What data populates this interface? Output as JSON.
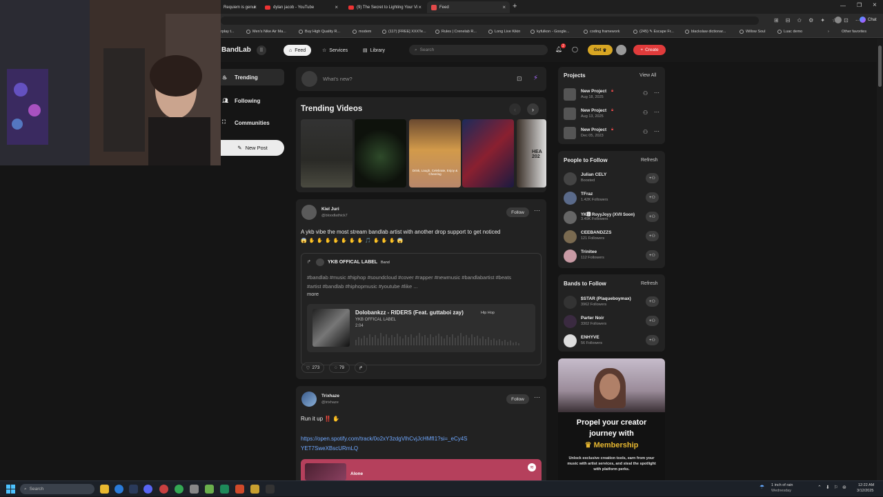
{
  "browser": {
    "tabs": [
      {
        "label": "Requiem is genui"
      },
      {
        "label": "dylan jacob - YouTube"
      },
      {
        "label": "(9) The Secret to Lighting Your Vi"
      },
      {
        "label": "Feed"
      }
    ],
    "new_tab": "+",
    "bookmarks": [
      "rplay t...",
      "Men's Nike Air Ma...",
      "Buy High Quality R...",
      "modem",
      "(117) [FREE] XXXTe...",
      "Rules | Crenelab R...",
      "Long Live Kikin",
      "kyfulkon - Google...",
      "coding framework",
      "(245) ✎ Escape Fr...",
      "blackslaw dictionar...",
      "Willow Soul",
      "Luac demo"
    ],
    "other_favorites": "Other favorites",
    "chat_label": "Chat"
  },
  "header": {
    "logo": "BandLab",
    "nav": {
      "feed": "Feed",
      "services": "Services",
      "library": "Library"
    },
    "search_placeholder": "Search",
    "notif_count": "2",
    "get_label": "Get",
    "create_label": "Create"
  },
  "sidebar": {
    "items": [
      {
        "label": "Trending"
      },
      {
        "label": "Following"
      },
      {
        "label": "Communities"
      }
    ],
    "new_post": "New Post"
  },
  "composer": {
    "placeholder": "What's new?"
  },
  "trending": {
    "title": "Trending Videos",
    "video_captions": [
      "",
      "",
      "Drink, Laugh, Celebrate, Enjoy & Cheering",
      "",
      "HEA 202"
    ]
  },
  "post1": {
    "author": "Kiel Juri",
    "handle": "@bloodlathick7",
    "follow": "Follow",
    "text": "A ykb vibe the most stream bandlab artist with another drop support to get noticed",
    "emojis": "😱 ✋ ✋ ✋ ✋ ✋ ✋ ✋ 🎵 ✋ ✋ ✋ 😱",
    "shared_label": "YKB OFFICAL LABEL",
    "shared_badge": "Band",
    "hashtags": "#bandlab #music #hiphop #soundcloud #cover #rapper #newmusic #bandlabartist #beats #artist #bandlab #hiphopmusic #youtube #like ...",
    "more": "more",
    "track_title": "Dolobankzz - RIDERS (Feat. guttaboi zay)",
    "track_genre": "Hip Hop",
    "track_artist": "YKB OFFICAL LABEL",
    "track_duration": "2:04",
    "likes": "273",
    "comments": "79"
  },
  "post2": {
    "author": "Trixhaze",
    "handle": "@trixhaze",
    "follow": "Follow",
    "text": "Run it up ‼️ ✋",
    "link": "https://open.spotify.com/track/0o2xY3zdgVlhCvjJcHMfI1?si=_eCy4SYET7SweXBscURmLQ",
    "track_title": "Alone"
  },
  "projects": {
    "title": "Projects",
    "view_all": "View All",
    "items": [
      {
        "name": "New Project",
        "date": "Aug 18, 2025"
      },
      {
        "name": "New Project",
        "date": "Aug 13, 2025"
      },
      {
        "name": "New Project",
        "date": "Dec 05, 2023"
      }
    ]
  },
  "people": {
    "title": "People to Follow",
    "refresh": "Refresh",
    "items": [
      {
        "name": "Julian CELY",
        "sub": "Boosted"
      },
      {
        "name": "TFraz",
        "sub": "1.42K Followers"
      },
      {
        "name": "YK🅱 RoyyJoyy (XVII Soon)",
        "sub": "3.49K Followers"
      },
      {
        "name": "CEEBANDZZS",
        "sub": "121 Followers"
      },
      {
        "name": "Trinitee",
        "sub": "112 Followers"
      }
    ]
  },
  "bands": {
    "title": "Bands to Follow",
    "refresh": "Refresh",
    "items": [
      {
        "name": "$STAR (Plaqueboymax)",
        "sub": "3962 Followers"
      },
      {
        "name": "Parter Noir",
        "sub": "3302 Followers"
      },
      {
        "name": "ENHYVE",
        "sub": "56 Followers"
      }
    ]
  },
  "promo": {
    "headline_1": "Propel your creator",
    "headline_2": "journey with",
    "headline_3": "Membership",
    "body": "Unlock exclusive creation tools, earn from your music with artist services, and steal the spotlight with platform perks."
  },
  "taskbar": {
    "search": "Search",
    "weather": "1 inch of rain",
    "weather_day": "Wednesday",
    "time": "12:22 AM",
    "date": "3/12/2025"
  }
}
